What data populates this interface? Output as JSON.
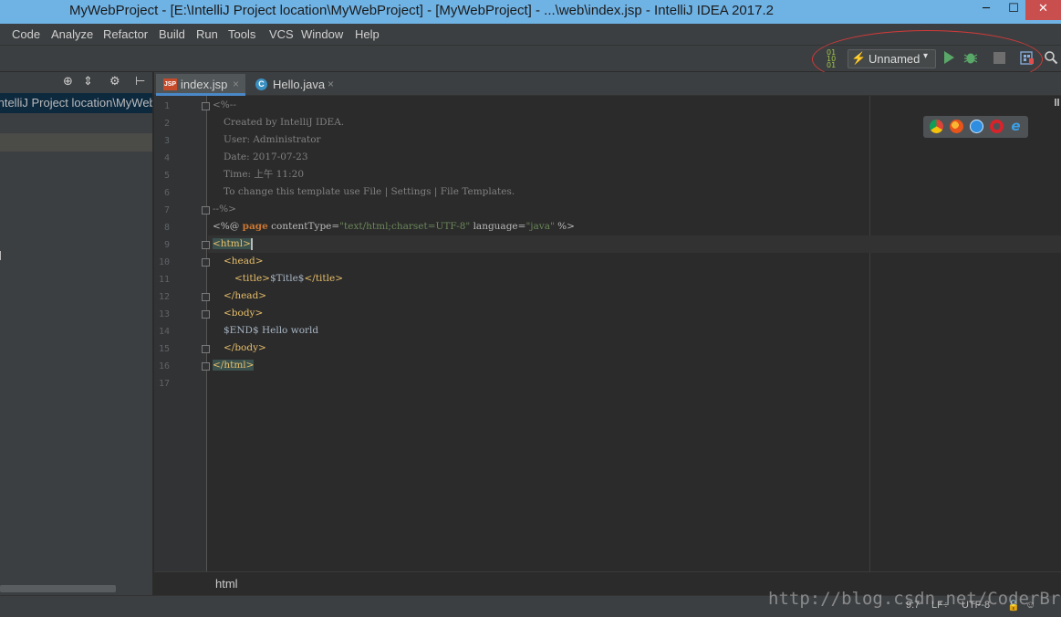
{
  "window": {
    "title": "MyWebProject - [E:\\IntelliJ Project location\\MyWebProject] - [MyWebProject] - ...\\web\\index.jsp - IntelliJ IDEA 2017.2",
    "minimize": "─",
    "maximize": "☐",
    "close": "✕"
  },
  "menu": [
    "Code",
    "Analyze",
    "Refactor",
    "Build",
    "Run",
    "Tools",
    "VCS",
    "Window",
    "Help"
  ],
  "toolbar": {
    "run_config_label": "Unnamed",
    "run_config_dropdown": "▾",
    "icons": [
      "binary-toggle-icon",
      "run-icon",
      "debug-icon",
      "stop-icon",
      "project-structure-icon",
      "search-icon"
    ]
  },
  "sidebar": {
    "path": "IntelliJ Project location\\MyWebProject"
  },
  "tabs": [
    {
      "label": "index.jsp",
      "icon_text": "JSP",
      "close": "×",
      "active": true
    },
    {
      "label": "Hello.java",
      "icon_text": "C",
      "close": "×",
      "active": false
    }
  ],
  "editor": {
    "line_numbers": [
      "1",
      "2",
      "3",
      "4",
      "5",
      "6",
      "7",
      "8",
      "9",
      "10",
      "11",
      "12",
      "13",
      "14",
      "15",
      "16",
      "17"
    ],
    "lines": {
      "l1": "<%--",
      "l2": "Created by IntelliJ IDEA.",
      "l3": "User: Administrator",
      "l4": "Date: 2017-07-23",
      "l5": "Time: 上午 11:20",
      "l6": "To change this template use File | Settings | File Templates.",
      "l7": "--%>",
      "l8_open": "<%@ ",
      "l8_kw": "page",
      "l8_attr1": " contentType=",
      "l8_val1": "\"text/html;charset=UTF-8\"",
      "l8_attr2": " language=",
      "l8_val2": "\"java\"",
      "l8_close": " %>",
      "l9": "<html>",
      "l10": "<head>",
      "l11_open": "<title>",
      "l11_text": "$Title$",
      "l11_close": "</title>",
      "l12": "</head>",
      "l13": "<body>",
      "l14": "$END$ Hello world",
      "l15": "</body>",
      "l16": "</html>"
    }
  },
  "breadcrumb": "html",
  "status": {
    "position": "9:7",
    "line_sep": "LF÷",
    "encoding": "UTF-8"
  },
  "watermark": "http://blog.csdn.net/CoderBruis"
}
